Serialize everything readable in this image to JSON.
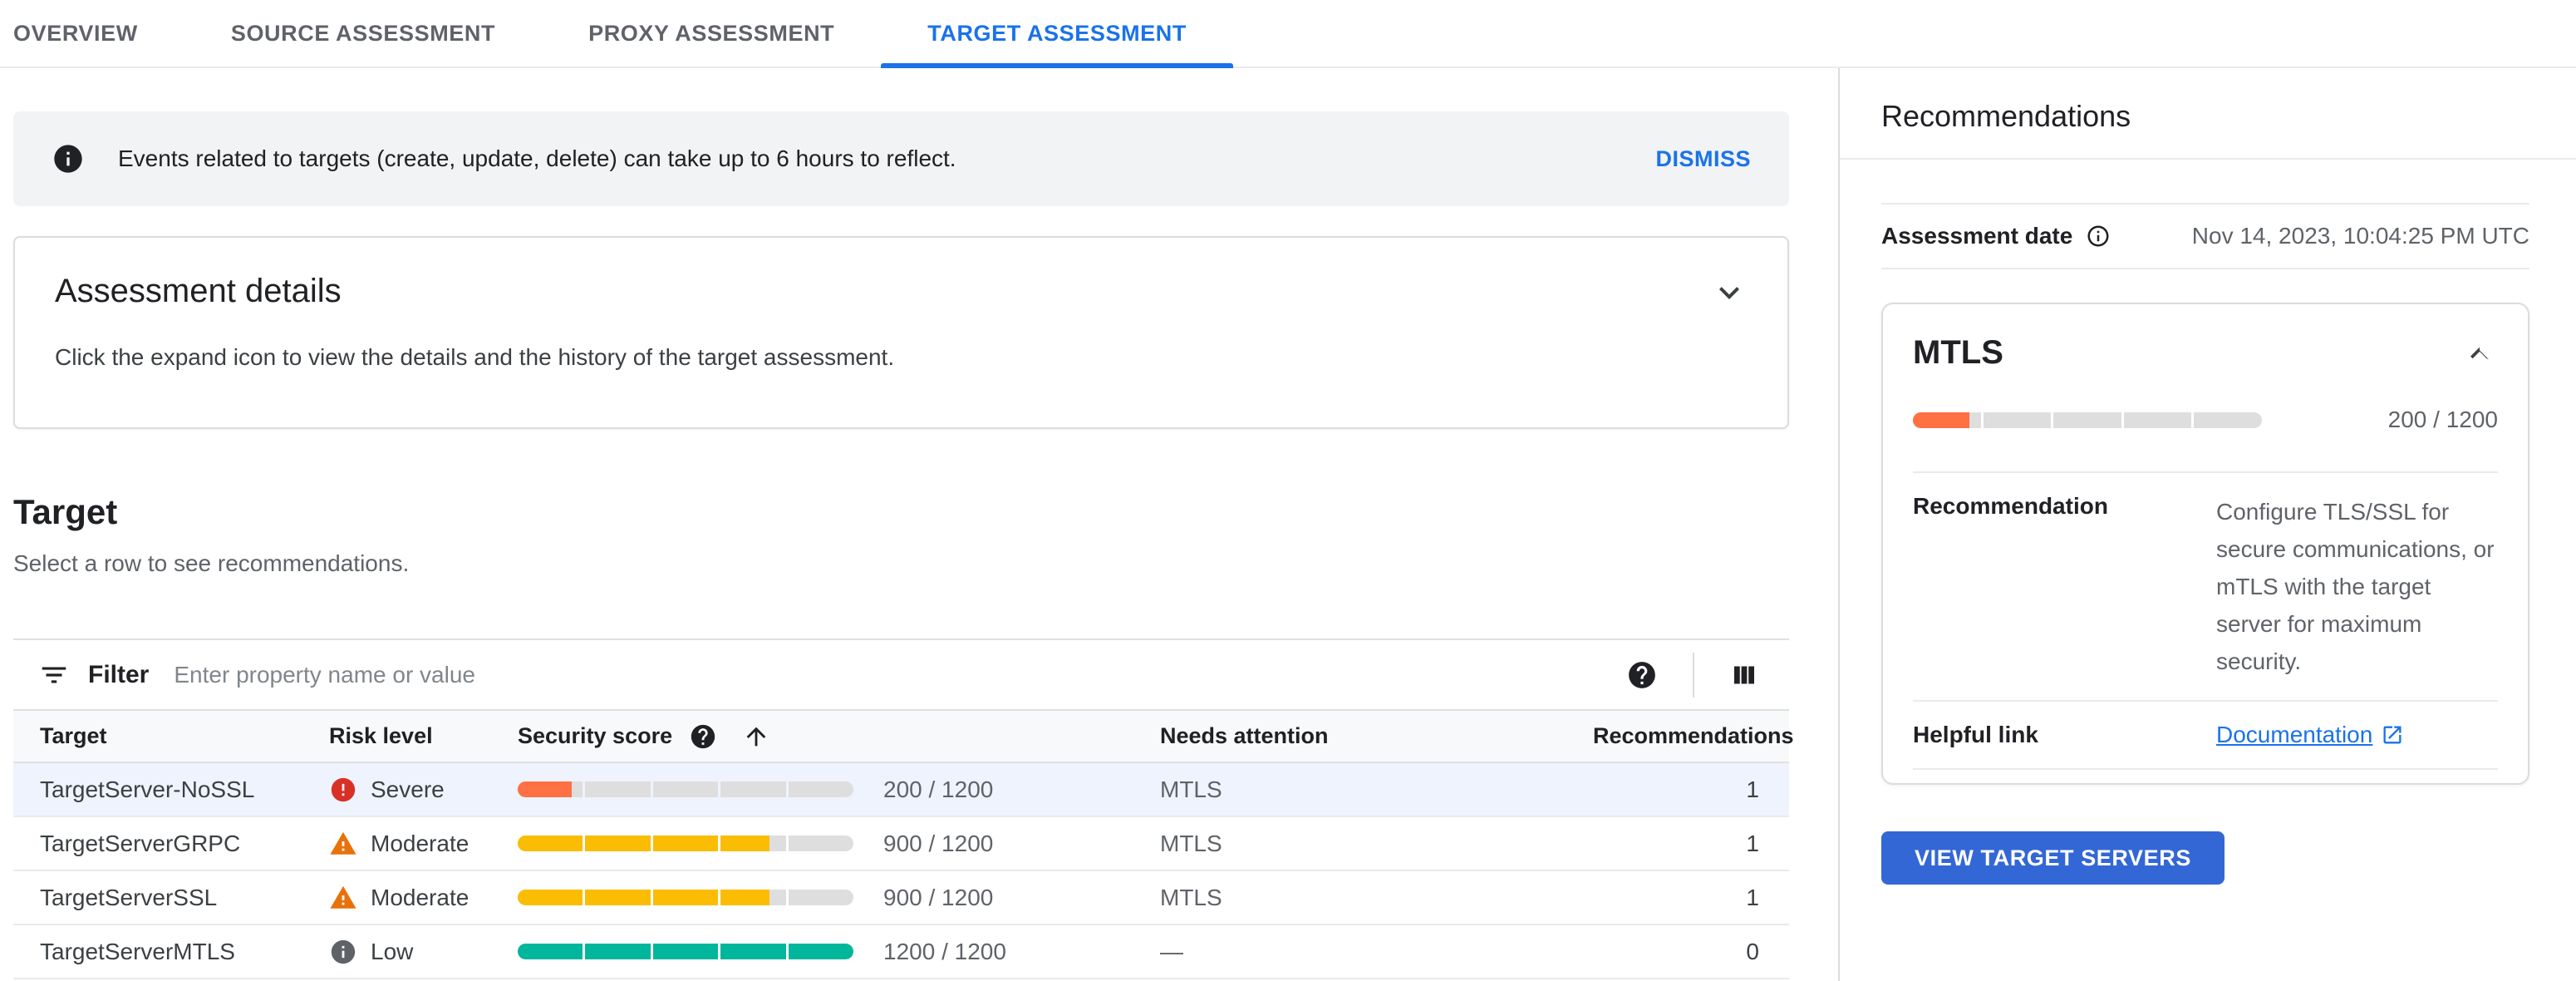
{
  "tabs": [
    {
      "label": "OVERVIEW",
      "active": false
    },
    {
      "label": "SOURCE ASSESSMENT",
      "active": false
    },
    {
      "label": "PROXY ASSESSMENT",
      "active": false
    },
    {
      "label": "TARGET ASSESSMENT",
      "active": true
    }
  ],
  "banner": {
    "text": "Events related to targets (create, update, delete) can take up to 6 hours to reflect.",
    "dismiss_label": "DISMISS"
  },
  "assessment_details": {
    "title": "Assessment details",
    "description": "Click the expand icon to view the details and the history of the target assessment."
  },
  "target_section": {
    "title": "Target",
    "subtitle": "Select a row to see recommendations."
  },
  "filter": {
    "label": "Filter",
    "placeholder": "Enter property name or value"
  },
  "table": {
    "columns": {
      "target": "Target",
      "risk": "Risk level",
      "score": "Security score",
      "needs_attention": "Needs attention",
      "recommendations": "Recommendations"
    },
    "rows": [
      {
        "target": "TargetServer-NoSSL",
        "risk_level": "Severe",
        "risk_type": "severe",
        "score": 200,
        "max": 1200,
        "score_text": "200 / 1200",
        "needs_attention": "MTLS",
        "recommendations": "1",
        "selected": true
      },
      {
        "target": "TargetServerGRPC",
        "risk_level": "Moderate",
        "risk_type": "moderate",
        "score": 900,
        "max": 1200,
        "score_text": "900 / 1200",
        "needs_attention": "MTLS",
        "recommendations": "1",
        "selected": false
      },
      {
        "target": "TargetServerSSL",
        "risk_level": "Moderate",
        "risk_type": "moderate",
        "score": 900,
        "max": 1200,
        "score_text": "900 / 1200",
        "needs_attention": "MTLS",
        "recommendations": "1",
        "selected": false
      },
      {
        "target": "TargetServerMTLS",
        "risk_level": "Low",
        "risk_type": "low",
        "score": 1200,
        "max": 1200,
        "score_text": "1200 / 1200",
        "needs_attention": "—",
        "recommendations": "0",
        "selected": false
      }
    ]
  },
  "panel": {
    "title": "Recommendations",
    "date_label": "Assessment date",
    "date_value": "Nov 14, 2023, 10:04:25 PM UTC",
    "card": {
      "title": "MTLS",
      "score": 200,
      "max": 1200,
      "risk_type": "severe",
      "score_text": "200 / 1200",
      "rec_label": "Recommendation",
      "rec_text": "Configure TLS/SSL for secure communications, or mTLS with the target server for maximum security.",
      "link_label": "Helpful link",
      "link_text": "Documentation"
    },
    "button_label": "VIEW TARGET SERVERS"
  },
  "colors": {
    "severe_bar": "#ff7043",
    "moderate_bar": "#fbbc04",
    "low_bar": "#00b69b",
    "bar_track": "#dedede",
    "severe_icon": "#d93025",
    "moderate_icon": "#e8710a",
    "low_icon": "#5f6368",
    "accent_blue": "#1a73e8",
    "button_blue": "#3367d6",
    "selected_row_bg": "#eef3fd"
  }
}
